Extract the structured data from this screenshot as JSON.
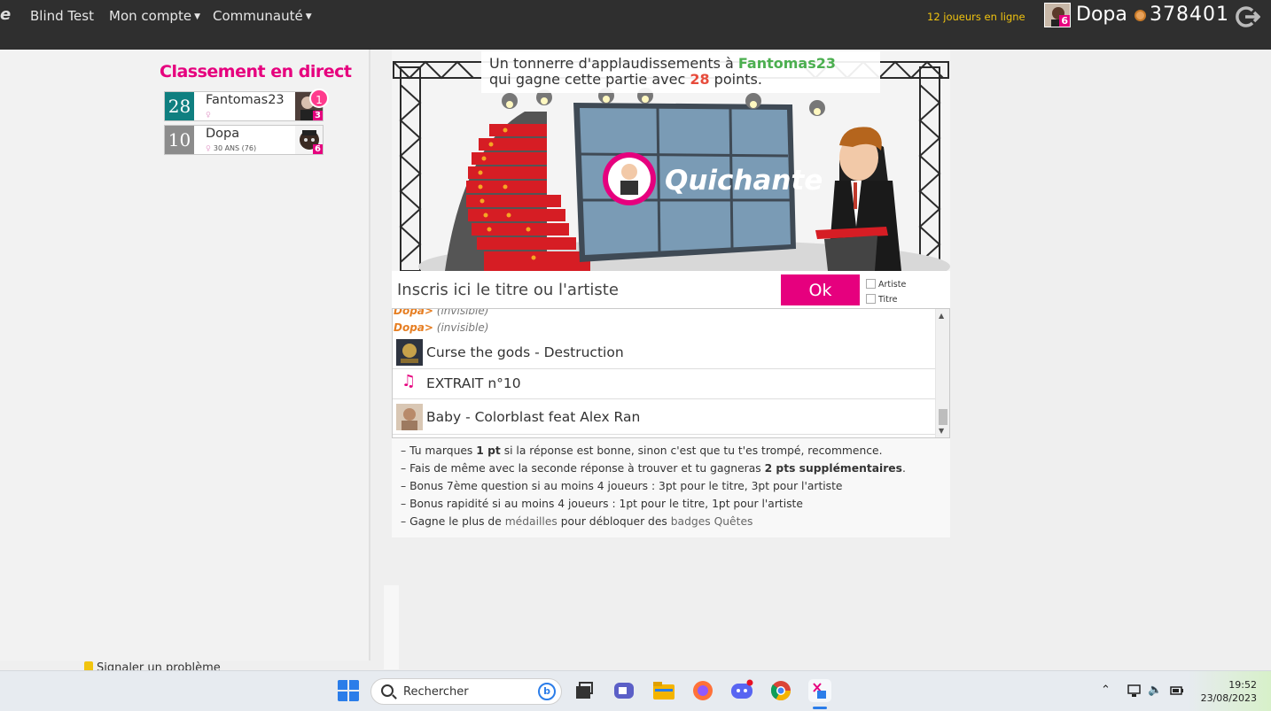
{
  "nav": {
    "logo_fragment": "e",
    "items": [
      {
        "label": "Blind Test",
        "caret": false
      },
      {
        "label": "Mon compte",
        "caret": true
      },
      {
        "label": "Communauté",
        "caret": true
      }
    ],
    "online": "12 joueurs en ligne",
    "user": {
      "name": "Dopa",
      "level": "6",
      "coins": "378401"
    }
  },
  "ranking": {
    "title": "Classement en direct",
    "notification": "1",
    "players": [
      {
        "score": "28",
        "name": "Fantomas23",
        "info": "",
        "level": "3",
        "color": "#0f7f80"
      },
      {
        "score": "10",
        "name": "Dopa",
        "info": "30 ANS (76)",
        "level": "6",
        "color": "#8c8c8c"
      }
    ],
    "footer": "Signaler un problème"
  },
  "banner": {
    "line1_prefix": "Un tonnerre d'applaudissements à ",
    "winner": "Fantomas23",
    "line2_prefix": "qui gagne cette partie avec ",
    "points": "28",
    "line2_suffix": " points."
  },
  "stage": {
    "screen_title": "Quichante"
  },
  "answer": {
    "placeholder": "Inscris ici le titre ou l'artiste",
    "ok_label": "Ok",
    "artist_label": "Artiste",
    "title_label": "Titre"
  },
  "log": {
    "chats": [
      {
        "who": "Dopa>",
        "msg": "(invisible)"
      },
      {
        "who": "Dopa>",
        "msg": "(invisible)"
      }
    ],
    "rows": [
      {
        "text": "Curse the gods - Destruction",
        "icon": "album-cover"
      },
      {
        "text": "EXTRAIT n°10",
        "icon": "music-note-icon"
      },
      {
        "text": "Baby - Colorblast feat Alex Ran",
        "icon": "album-cover"
      }
    ]
  },
  "rules": {
    "r1_a": "Tu marques ",
    "r1_b": "1 pt",
    "r1_c": " si la réponse est bonne, sinon c'est que tu t'es trompé, recommence.",
    "r2_a": "Fais de même avec la seconde réponse à trouver et tu gagneras ",
    "r2_b": "2 pts supplémentaires",
    "r3": "Bonus 7ème question si au moins 4 joueurs : 3pt pour le titre, 3pt pour l'artiste",
    "r4": "Bonus rapidité si au moins 4 joueurs : 1pt pour le titre, 1pt pour l'artiste",
    "r5_a": "Gagne le plus de ",
    "r5_b": "médailles",
    "r5_c": " pour débloquer des ",
    "r5_d": "badges Quêtes"
  },
  "taskbar": {
    "search_placeholder": "Rechercher",
    "time": "19:52",
    "date": "23/08/2023"
  }
}
